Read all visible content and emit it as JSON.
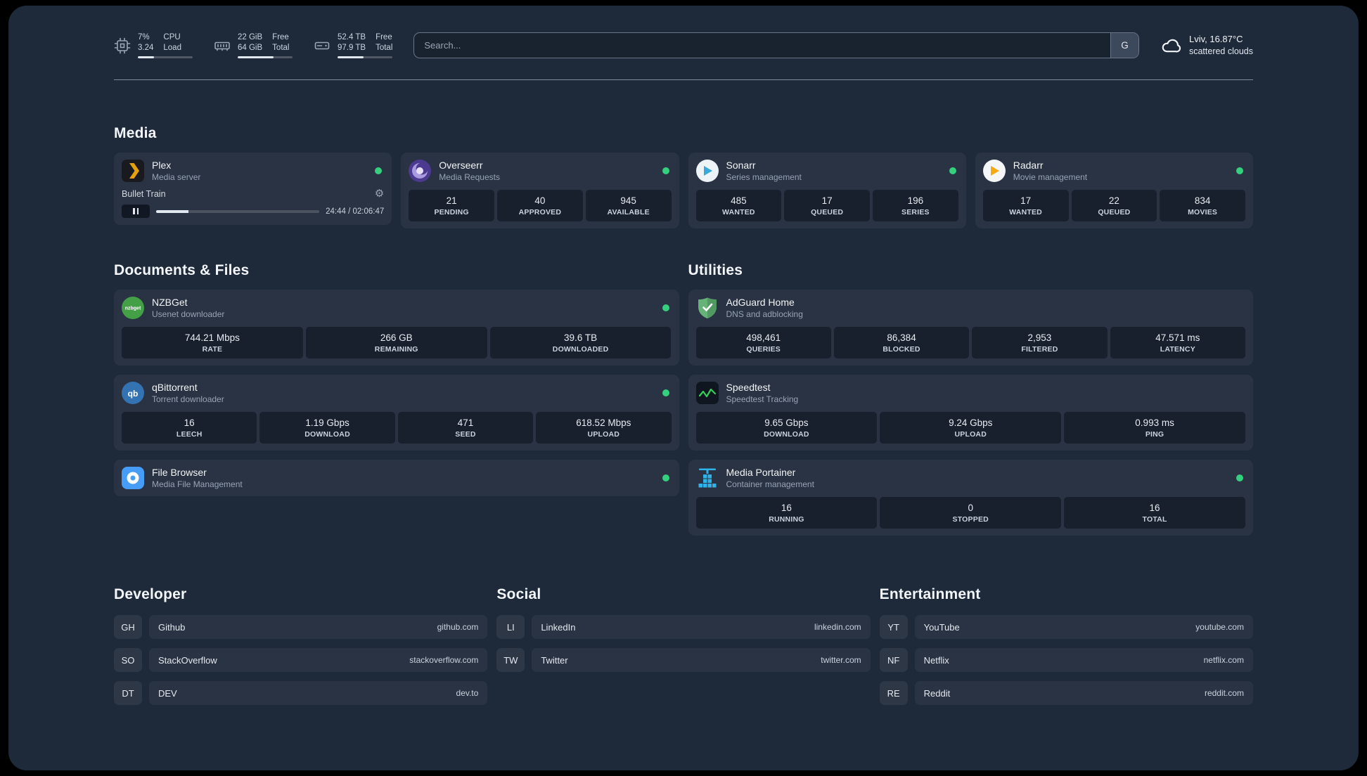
{
  "topbar": {
    "cpu": {
      "icon": "cpu-icon",
      "values": [
        "7%",
        "3.24"
      ],
      "labels": [
        "CPU",
        "Load"
      ],
      "progress_pct": 30
    },
    "memory": {
      "icon": "memory-icon",
      "values": [
        "22 GiB",
        "64 GiB"
      ],
      "labels": [
        "Free",
        "Total"
      ],
      "progress_pct": 66
    },
    "disk": {
      "icon": "disk-icon",
      "values": [
        "52.4 TB",
        "97.9 TB"
      ],
      "labels": [
        "Free",
        "Total"
      ],
      "progress_pct": 47
    },
    "search": {
      "placeholder": "Search...",
      "provider_label": "G"
    },
    "weather": {
      "icon": "cloud-icon",
      "location": "Lviv, 16.87°C",
      "condition": "scattered clouds"
    }
  },
  "groups": [
    {
      "title": "Media",
      "services": [
        {
          "name": "Plex",
          "description": "Media server",
          "icon": "plex",
          "status": true,
          "player": {
            "track": "Bullet Train",
            "time": "24:44 / 02:06:47",
            "progress_pct": 20
          }
        },
        {
          "name": "Overseerr",
          "description": "Media Requests",
          "icon": "overseerr",
          "status": true,
          "stats": [
            {
              "value": "21",
              "label": "PENDING"
            },
            {
              "value": "40",
              "label": "APPROVED"
            },
            {
              "value": "945",
              "label": "AVAILABLE"
            }
          ]
        },
        {
          "name": "Sonarr",
          "description": "Series management",
          "icon": "sonarr",
          "status": true,
          "stats": [
            {
              "value": "485",
              "label": "WANTED"
            },
            {
              "value": "17",
              "label": "QUEUED"
            },
            {
              "value": "196",
              "label": "SERIES"
            }
          ]
        },
        {
          "name": "Radarr",
          "description": "Movie management",
          "icon": "radarr",
          "status": true,
          "stats": [
            {
              "value": "17",
              "label": "WANTED"
            },
            {
              "value": "22",
              "label": "QUEUED"
            },
            {
              "value": "834",
              "label": "MOVIES"
            }
          ]
        }
      ]
    },
    {
      "title": "Documents & Files",
      "services": [
        {
          "name": "NZBGet",
          "description": "Usenet downloader",
          "icon": "nzbget",
          "status": true,
          "stats": [
            {
              "value": "744.21 Mbps",
              "label": "RATE"
            },
            {
              "value": "266 GB",
              "label": "REMAINING"
            },
            {
              "value": "39.6 TB",
              "label": "DOWNLOADED"
            }
          ]
        },
        {
          "name": "qBittorrent",
          "description": "Torrent downloader",
          "icon": "qbittorrent",
          "status": true,
          "stats": [
            {
              "value": "16",
              "label": "LEECH"
            },
            {
              "value": "1.19 Gbps",
              "label": "DOWNLOAD"
            },
            {
              "value": "471",
              "label": "SEED"
            },
            {
              "value": "618.52 Mbps",
              "label": "UPLOAD"
            }
          ]
        },
        {
          "name": "File Browser",
          "description": "Media File Management",
          "icon": "filebrowser",
          "status": true,
          "stats": []
        }
      ]
    },
    {
      "title": "Utilities",
      "services": [
        {
          "name": "AdGuard Home",
          "description": "DNS and adblocking",
          "icon": "adguard",
          "status": false,
          "stats": [
            {
              "value": "498,461",
              "label": "QUERIES"
            },
            {
              "value": "86,384",
              "label": "BLOCKED"
            },
            {
              "value": "2,953",
              "label": "FILTERED"
            },
            {
              "value": "47.571 ms",
              "label": "LATENCY"
            }
          ]
        },
        {
          "name": "Speedtest",
          "description": "Speedtest Tracking",
          "icon": "speedtest",
          "status": false,
          "stats": [
            {
              "value": "9.65 Gbps",
              "label": "DOWNLOAD"
            },
            {
              "value": "9.24 Gbps",
              "label": "UPLOAD"
            },
            {
              "value": "0.993 ms",
              "label": "PING"
            }
          ]
        },
        {
          "name": "Media Portainer",
          "description": "Container management",
          "icon": "portainer",
          "status": true,
          "stats": [
            {
              "value": "16",
              "label": "RUNNING"
            },
            {
              "value": "0",
              "label": "STOPPED"
            },
            {
              "value": "16",
              "label": "TOTAL"
            }
          ]
        }
      ]
    }
  ],
  "bookmarks": [
    {
      "title": "Developer",
      "items": [
        {
          "abbr": "GH",
          "name": "Github",
          "domain": "github.com"
        },
        {
          "abbr": "SO",
          "name": "StackOverflow",
          "domain": "stackoverflow.com"
        },
        {
          "abbr": "DT",
          "name": "DEV",
          "domain": "dev.to"
        }
      ]
    },
    {
      "title": "Social",
      "items": [
        {
          "abbr": "LI",
          "name": "LinkedIn",
          "domain": "linkedin.com"
        },
        {
          "abbr": "TW",
          "name": "Twitter",
          "domain": "twitter.com"
        }
      ]
    },
    {
      "title": "Entertainment",
      "items": [
        {
          "abbr": "YT",
          "name": "YouTube",
          "domain": "youtube.com"
        },
        {
          "abbr": "NF",
          "name": "Netflix",
          "domain": "netflix.com"
        },
        {
          "abbr": "RE",
          "name": "Reddit",
          "domain": "reddit.com"
        }
      ]
    }
  ]
}
